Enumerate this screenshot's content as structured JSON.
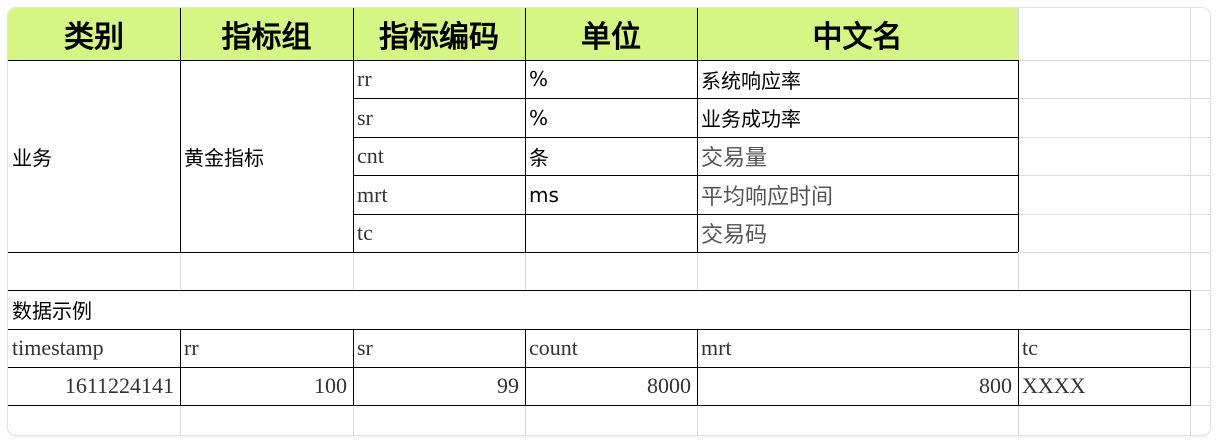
{
  "header": {
    "category": "类别",
    "group": "指标组",
    "code": "指标编码",
    "unit": "单位",
    "cn_name": "中文名"
  },
  "metrics": {
    "category": "业务",
    "group": "黄金指标",
    "rows": [
      {
        "code": "rr",
        "unit": "%",
        "name": "系统响应率"
      },
      {
        "code": "sr",
        "unit": "%",
        "name": "业务成功率"
      },
      {
        "code": "cnt",
        "unit": "条",
        "name": "交易量"
      },
      {
        "code": "mrt",
        "unit": "ms",
        "name": "平均响应时间"
      },
      {
        "code": "tc",
        "unit": "",
        "name": "交易码"
      }
    ]
  },
  "example": {
    "title": "数据示例",
    "columns": [
      "timestamp",
      "rr",
      "sr",
      "count",
      "mrt",
      "tc"
    ],
    "row": [
      "1611224141",
      "100",
      "99",
      "8000",
      "800",
      "XXXX"
    ]
  }
}
